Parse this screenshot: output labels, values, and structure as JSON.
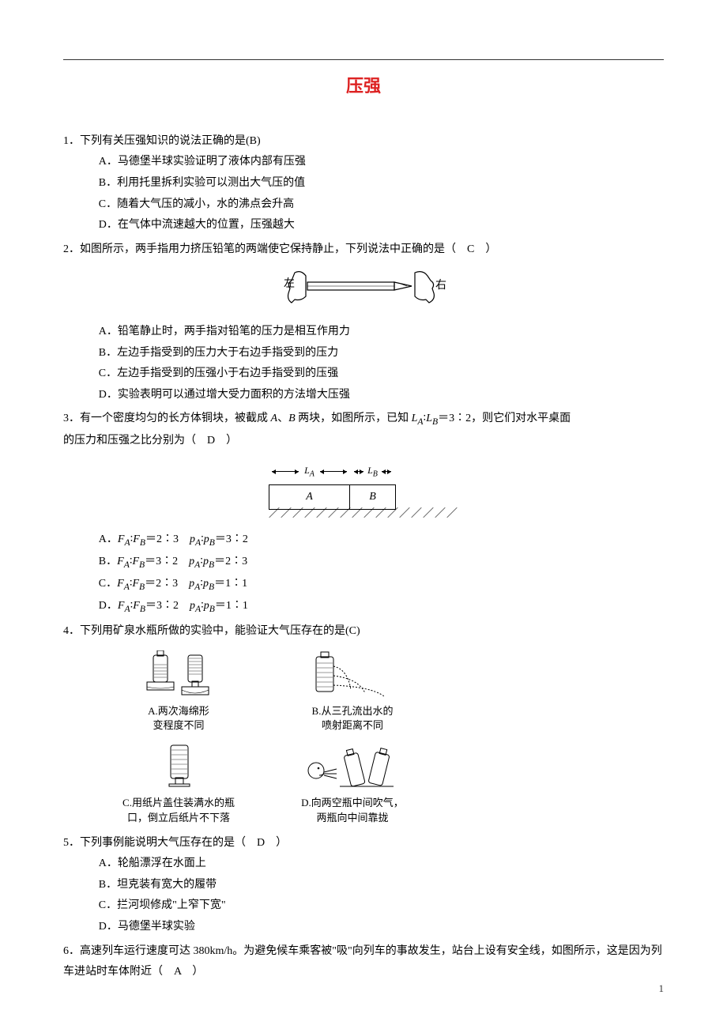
{
  "title": "压强",
  "page_number": "1",
  "q1": {
    "stem": "1．下列有关压强知识的说法正确的是(B)",
    "A": "A．马德堡半球实验证明了液体内部有压强",
    "B": "B．利用托里拆利实验可以测出大气压的值",
    "C": "C．随着大气压的减小，水的沸点会升高",
    "D": "D．在气体中流速越大的位置，压强越大"
  },
  "q2": {
    "stem": "2．如图所示，两手指用力挤压铅笔的两端使它保持静止，下列说法中正确的是（　C　）",
    "left_label": "左",
    "right_label": "右",
    "A": "A．铅笔静止时，两手指对铅笔的压力是相互作用力",
    "B": "B．左边手指受到的压力大于右边手指受到的压力",
    "C": "C．左边手指受到的压强小于右边手指受到的压强",
    "D": "D．实验表明可以通过增大受力面积的方法增大压强"
  },
  "q3": {
    "stem_a": "3．有一个密度均匀的长方体铜块，被截成 ",
    "stem_b": "、",
    "stem_c": " 两块，如图所示，已知 ",
    "stem_d": "＝3∶2，则它们对水平桌面",
    "stem_e": "的压力和压强之比分别为（　D　）",
    "A_label": "A．",
    "B_label": "B．",
    "C_label": "C．",
    "D_label": "D．",
    "A_body": "F_A∶F_B＝2∶3　p_A∶p_B＝3∶2",
    "B_body": "F_A∶F_B＝3∶2　p_A∶p_B＝2∶3",
    "C_body": "F_A∶F_B＝2∶3　p_A∶p_B＝1∶1",
    "D_body": "F_A∶F_B＝3∶2　p_A∶p_B＝1∶1",
    "block_A": "A",
    "block_B": "B",
    "dim_LA": "L_A",
    "dim_LB": "L_B"
  },
  "q4": {
    "stem": "4．下列用矿泉水瓶所做的实验中，能验证大气压存在的是(C)",
    "cap_A1": "A.两次海绵形",
    "cap_A2": "变程度不同",
    "cap_B1": "B.从三孔流出水的",
    "cap_B2": "喷射距离不同",
    "cap_C1": "C.用纸片盖住装满水的瓶",
    "cap_C2": "口，倒立后纸片不下落",
    "cap_D1": "D.向两空瓶中间吹气，",
    "cap_D2": "两瓶向中间靠拢"
  },
  "q5": {
    "stem": "5．下列事例能说明大气压存在的是（　D　）",
    "A": "A．轮船漂浮在水面上",
    "B": "B．坦克装有宽大的履带",
    "C": "C．拦河坝修成\"上窄下宽\"",
    "D": "D．马德堡半球实验"
  },
  "q6": {
    "stem": "6．高速列车运行速度可达 380km/h。为避免候车乘客被\"吸\"向列车的事故发生，站台上设有安全线，如图所示，这是因为列车进站时车体附近（　A　）"
  }
}
